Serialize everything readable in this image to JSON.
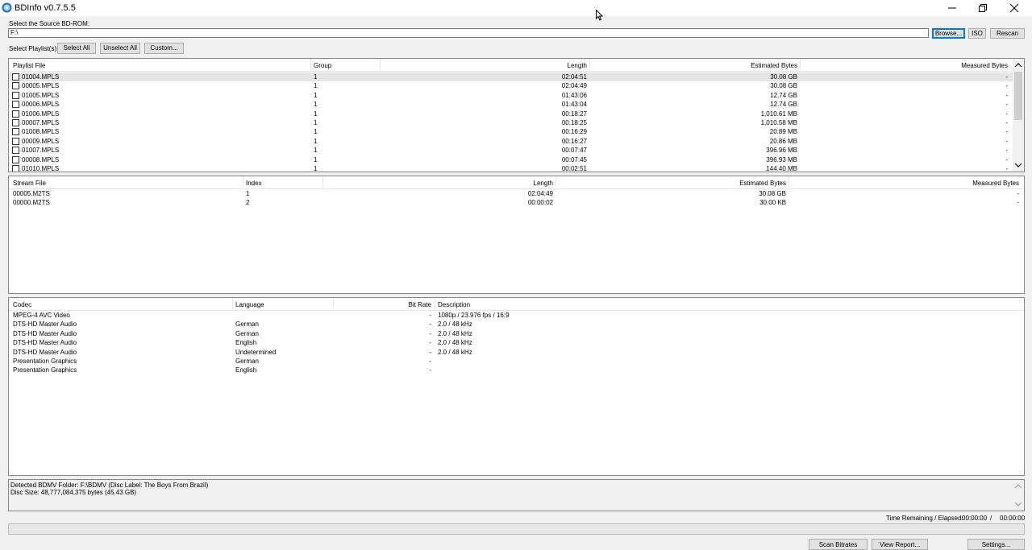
{
  "window": {
    "title": "BDInfo v0.7.5.5"
  },
  "source": {
    "label": "Select the Source BD-ROM:",
    "path": "F:\\",
    "browse_label": "Browse...",
    "iso_label": "ISO",
    "rescan_label": "Rescan"
  },
  "playlist_controls": {
    "label": "Select Playlist(s):",
    "select_all": "Select All",
    "unselect_all": "Unselect All",
    "custom": "Custom..."
  },
  "playlists": {
    "headers": [
      "Playlist File",
      "Group",
      "Length",
      "Estimated Bytes",
      "Measured Bytes"
    ],
    "rows": [
      [
        "01004.MPLS",
        "1",
        "02:04:51",
        "30.08 GB",
        "-"
      ],
      [
        "00005.MPLS",
        "1",
        "02:04:49",
        "30.08 GB",
        "-"
      ],
      [
        "01005.MPLS",
        "1",
        "01:43:06",
        "12.74 GB",
        "-"
      ],
      [
        "00006.MPLS",
        "1",
        "01:43:04",
        "12.74 GB",
        "-"
      ],
      [
        "01006.MPLS",
        "1",
        "00:18:27",
        "1,010.61 MB",
        "-"
      ],
      [
        "00007.MPLS",
        "1",
        "00:18:25",
        "1,010.58 MB",
        "-"
      ],
      [
        "01008.MPLS",
        "1",
        "00:16:29",
        "20.89 MB",
        "-"
      ],
      [
        "00009.MPLS",
        "1",
        "00:16:27",
        "20.86 MB",
        "-"
      ],
      [
        "01007.MPLS",
        "1",
        "00:07:47",
        "396.96 MB",
        "-"
      ],
      [
        "00008.MPLS",
        "1",
        "00:07:45",
        "396.93 MB",
        "-"
      ],
      [
        "01010.MPLS",
        "1",
        "00:02:51",
        "144.40 MB",
        "-"
      ]
    ]
  },
  "streams": {
    "headers": [
      "Stream File",
      "Index",
      "Length",
      "Estimated Bytes",
      "Measured Bytes"
    ],
    "rows": [
      [
        "00005.M2TS",
        "1",
        "02:04:49",
        "30.08 GB",
        "-"
      ],
      [
        "00000.M2TS",
        "2",
        "00:00:02",
        "30.00 KB",
        "-"
      ]
    ]
  },
  "codecs": {
    "headers": [
      "Codec",
      "Language",
      "Bit Rate",
      "Description"
    ],
    "rows": [
      [
        "MPEG-4 AVC Video",
        "",
        "-",
        "1080p / 23.976 fps / 16:9"
      ],
      [
        "DTS-HD Master Audio",
        "German",
        "-",
        "2.0 / 48 kHz"
      ],
      [
        "DTS-HD Master Audio",
        "German",
        "-",
        "2.0 / 48 kHz"
      ],
      [
        "DTS-HD Master Audio",
        "English",
        "-",
        "2.0 / 48 kHz"
      ],
      [
        "DTS-HD Master Audio",
        "Undetermined",
        "-",
        "2.0 / 48 kHz"
      ],
      [
        "Presentation Graphics",
        "German",
        "-",
        ""
      ],
      [
        "Presentation Graphics",
        "English",
        "-",
        ""
      ]
    ]
  },
  "status": {
    "line1": "Detected BDMV Folder: F:\\BDMV (Disc Label: The Boys From Brazil)",
    "line2": "Disc Size: 48,777,084,375 bytes (45.43 GB)"
  },
  "timing": {
    "label": "Time Remaining / Elapsed:",
    "remaining": "00:00:00",
    "separator": "/",
    "elapsed": "00:00:00"
  },
  "footer": {
    "scan_bitrates": "Scan Bitrates",
    "view_report": "View Report...",
    "settings": "Settings..."
  },
  "colors": {
    "focus": "#0078d7",
    "selected_row": "#e5e5e5"
  }
}
